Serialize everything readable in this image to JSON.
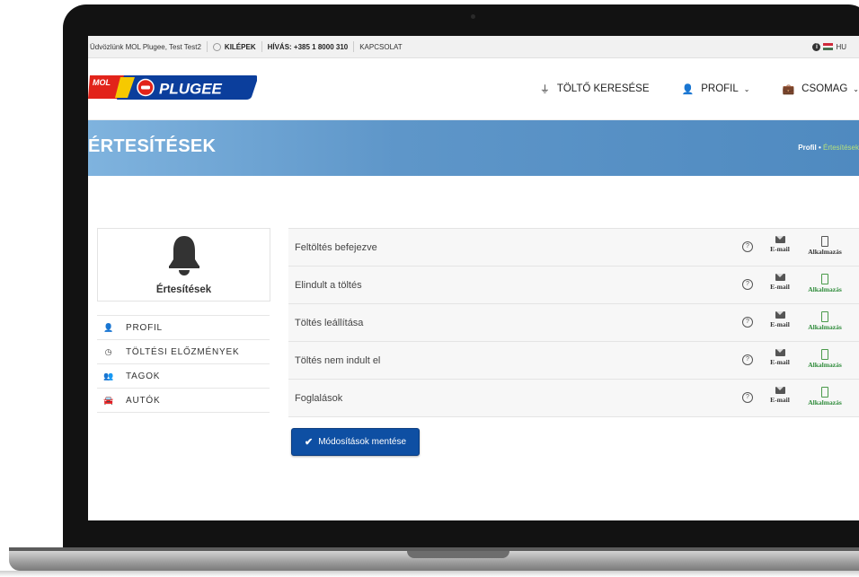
{
  "topbar": {
    "welcome": "Üdvözlünk MOL Plugee, Test Test2",
    "logout": "KILÉPEK",
    "call": "HÍVÁS: +385 1 8000 310",
    "contact": "KAPCSOLAT",
    "language": "HU"
  },
  "logo": {
    "mol": "MOL",
    "plugee": "PLUGEE"
  },
  "nav": {
    "charger_search": "TÖLTŐ KERESÉSE",
    "profile": "PROFIL",
    "package": "CSOMAG"
  },
  "banner": {
    "title": "ÉRTESÍTÉSEK",
    "crumb_home": "Profil",
    "crumb_sep": "•",
    "crumb_current": "Értesítések"
  },
  "sidebar": {
    "card_title": "Értesítések",
    "items": [
      {
        "label": "PROFIL",
        "icon": "user-icon"
      },
      {
        "label": "TÖLTÉSI ELŐZMÉNYEK",
        "icon": "clock-icon"
      },
      {
        "label": "TAGOK",
        "icon": "users-icon"
      },
      {
        "label": "AUTÓK",
        "icon": "car-icon"
      }
    ]
  },
  "channels": {
    "email": "E-mail",
    "app": "Alkalmazás"
  },
  "notifications": [
    {
      "label": "Feltöltés befejezve",
      "email": true,
      "app": false
    },
    {
      "label": "Elindult a töltés",
      "email": true,
      "app": true
    },
    {
      "label": "Töltés leállítása",
      "email": true,
      "app": true
    },
    {
      "label": "Töltés nem indult el",
      "email": true,
      "app": true
    },
    {
      "label": "Foglalások",
      "email": true,
      "app": true
    }
  ],
  "save_button": "Módosítások mentése",
  "colors": {
    "brand_blue": "#0e4fa3",
    "banner": "#5e96c9",
    "app_enabled": "#2e8b3a",
    "mol_red": "#e2231a"
  }
}
